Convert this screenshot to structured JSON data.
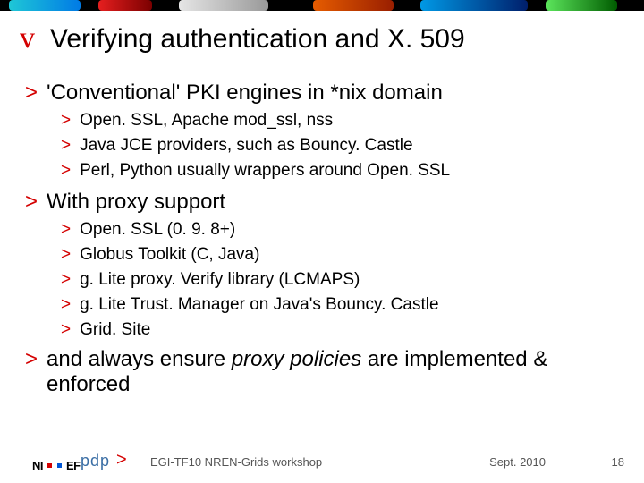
{
  "title": "Verifying authentication and X. 509",
  "bullets": {
    "l1a": "'Conventional' PKI engines in *nix domain",
    "l1a_sub": [
      "Open. SSL, Apache mod_ssl, nss",
      "Java JCE providers, such as Bouncy. Castle",
      "Perl, Python usually wrappers around Open. SSL"
    ],
    "l1b": "With proxy support",
    "l1b_sub": [
      "Open. SSL (0. 9. 8+)",
      "Globus Toolkit (C, Java)",
      "g. Lite proxy. Verify library (LCMAPS)",
      "g. Lite Trust. Manager on Java's Bouncy. Castle",
      "Grid. Site"
    ],
    "l1c_pre": "and always ensure ",
    "l1c_em": "proxy policies",
    "l1c_post": " are implemented & enforced"
  },
  "footer": {
    "logo": "NIKHEF",
    "pdp": "pdp",
    "center": "EGI-TF10 NREN-Grids workshop",
    "date": "Sept. 2010",
    "pagenum": "18"
  },
  "glyphs": {
    "vmark": "v",
    "gt": ">"
  }
}
